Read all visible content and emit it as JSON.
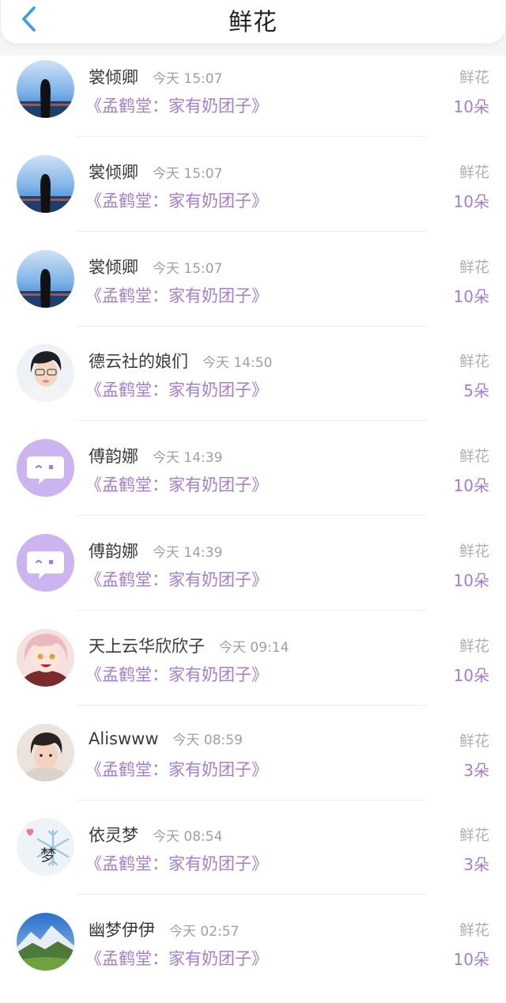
{
  "header": {
    "title": "鲜花"
  },
  "rows": [
    {
      "name": "裳倾卿",
      "time": "今天 15:07",
      "book": "《孟鹤堂：家有奶团子》",
      "gift": "鲜花",
      "count": "10朵"
    },
    {
      "name": "裳倾卿",
      "time": "今天 15:07",
      "book": "《孟鹤堂：家有奶团子》",
      "gift": "鲜花",
      "count": "10朵"
    },
    {
      "name": "裳倾卿",
      "time": "今天 15:07",
      "book": "《孟鹤堂：家有奶团子》",
      "gift": "鲜花",
      "count": "10朵"
    },
    {
      "name": "德云社的娘们",
      "time": "今天 14:50",
      "book": "《孟鹤堂：家有奶团子》",
      "gift": "鲜花",
      "count": "5朵"
    },
    {
      "name": "傅韵娜",
      "time": "今天 14:39",
      "book": "《孟鹤堂：家有奶团子》",
      "gift": "鲜花",
      "count": "10朵"
    },
    {
      "name": "傅韵娜",
      "time": "今天 14:39",
      "book": "《孟鹤堂：家有奶团子》",
      "gift": "鲜花",
      "count": "10朵"
    },
    {
      "name": "天上云华欣欣子",
      "time": "今天 09:14",
      "book": "《孟鹤堂：家有奶团子》",
      "gift": "鲜花",
      "count": "10朵"
    },
    {
      "name": "Aliswww",
      "time": "今天 08:59",
      "book": "《孟鹤堂：家有奶团子》",
      "gift": "鲜花",
      "count": "3朵"
    },
    {
      "name": "依灵梦",
      "time": "今天 08:54",
      "book": "《孟鹤堂：家有奶团子》",
      "gift": "鲜花",
      "count": "3朵"
    },
    {
      "name": "幽梦伊伊",
      "time": "今天 02:57",
      "book": "《孟鹤堂：家有奶团子》",
      "gift": "鲜花",
      "count": "10朵"
    }
  ],
  "avatar_watermark": "梦",
  "colors": {
    "accent": "#a47ed6",
    "back_arrow": "#3b9bf0",
    "muted": "#a0a0a0"
  }
}
